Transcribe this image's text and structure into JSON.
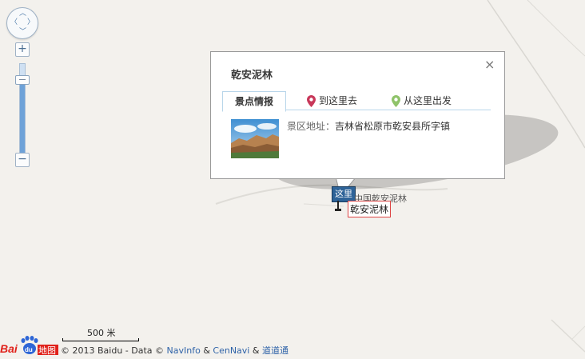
{
  "popup": {
    "title": "乾安泥林",
    "close_label": "×",
    "tabs": [
      {
        "label": "景点情报",
        "active": true
      },
      {
        "label": "到这里去",
        "pin_color": "#c8385a"
      },
      {
        "label": "从这里出发",
        "pin_color": "#8fc36a"
      }
    ],
    "address_label": "景区地址：",
    "address_value": "吉林省松原市乾安县所字镇"
  },
  "marker": {
    "sign_text": "这里",
    "map_label": "中国乾安泥林",
    "label": "乾安泥林"
  },
  "zoom_control": {
    "zoom_in_label": "+",
    "zoom_out_label": "−",
    "level_fraction": 0.84
  },
  "scale": {
    "label": "500 米"
  },
  "logo": {
    "brand_prefix": "Bai",
    "brand_suffix": "地图"
  },
  "copyright": {
    "prefix": "© 2013 Baidu - Data ©",
    "provider1": "NavInfo",
    "amp1": "&",
    "provider2": "CenNavi",
    "amp2": "&",
    "provider3": "道道通"
  },
  "colors": {
    "link": "#2f63a8",
    "map_bg": "#f3f1ed",
    "sign_bg": "#2e6398",
    "label_border": "#dd4444"
  }
}
